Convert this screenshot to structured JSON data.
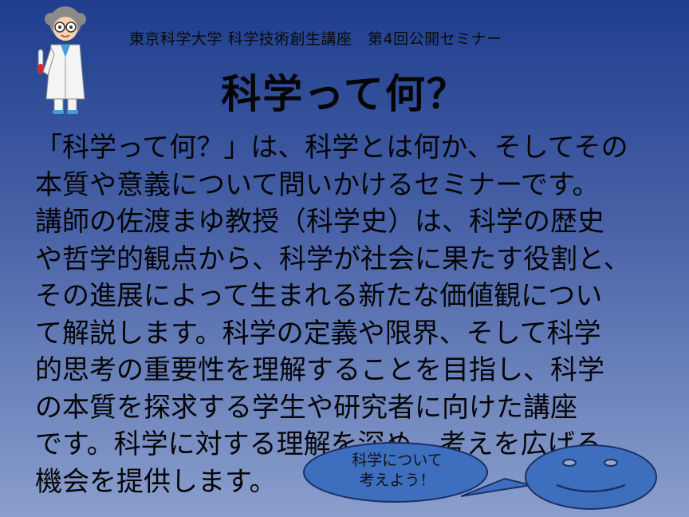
{
  "header": {
    "subtitle": "東京科学大学 科学技術創生講座　第4回公開セミナー",
    "title": "科学って何？"
  },
  "body": {
    "lines": [
      "「科学って何？」は、科学とは何か、そしてその",
      "本質や意義について問いかけるセミナーです。",
      "講師の佐渡まゆ教授（科学史）は、科学の歴史",
      "や哲学的観点から、科学が社会に果たす役割と、",
      "その進展によって生まれる新たな価値観につい",
      "て解説します。科学の定義や限界、そして科学",
      "的思考の重要性を理解することを目指し、科学",
      "の本質を探求する学生や研究者に向けた講座",
      "です。科学に対する理解を深め、考えを広げる",
      "機会を提供します。"
    ]
  },
  "speech_bubble": {
    "line1": "科学について",
    "line2": "考えよう！"
  },
  "colors": {
    "background_top": "#1f3e8e",
    "background_bottom": "#8a9fcd",
    "bubble_fill": "#3e6fbf",
    "face_fill": "#3e6fbf"
  }
}
